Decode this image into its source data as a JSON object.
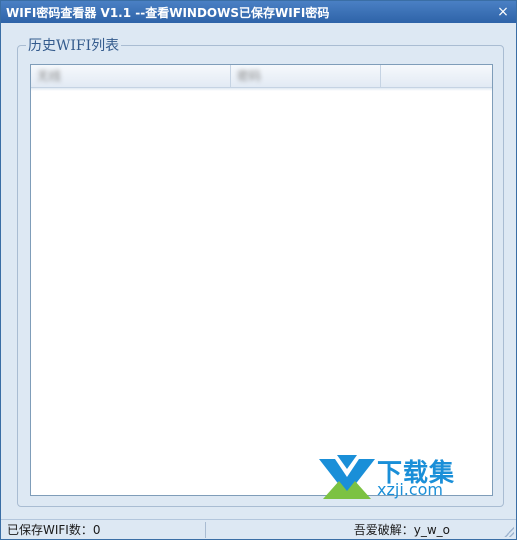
{
  "window": {
    "title": "WIFI密码查看器 V1.1 --查看WINDOWS已保存WIFI密码",
    "close_glyph": "×"
  },
  "group": {
    "legend": "历史WIFI列表"
  },
  "list": {
    "columns": [
      "无线",
      "密码",
      ""
    ]
  },
  "status": {
    "saved_count": "已保存WIFI数：0",
    "credit": "吾爱破解：y_w_o"
  },
  "watermark": {
    "brand_cn": "下载集",
    "brand_en": "xzji.com"
  },
  "colors": {
    "titlebar": "#2e63a8",
    "window_bg": "#dde8f3",
    "watermark_blue": "#1a8fd8",
    "watermark_green": "#7cc242"
  }
}
